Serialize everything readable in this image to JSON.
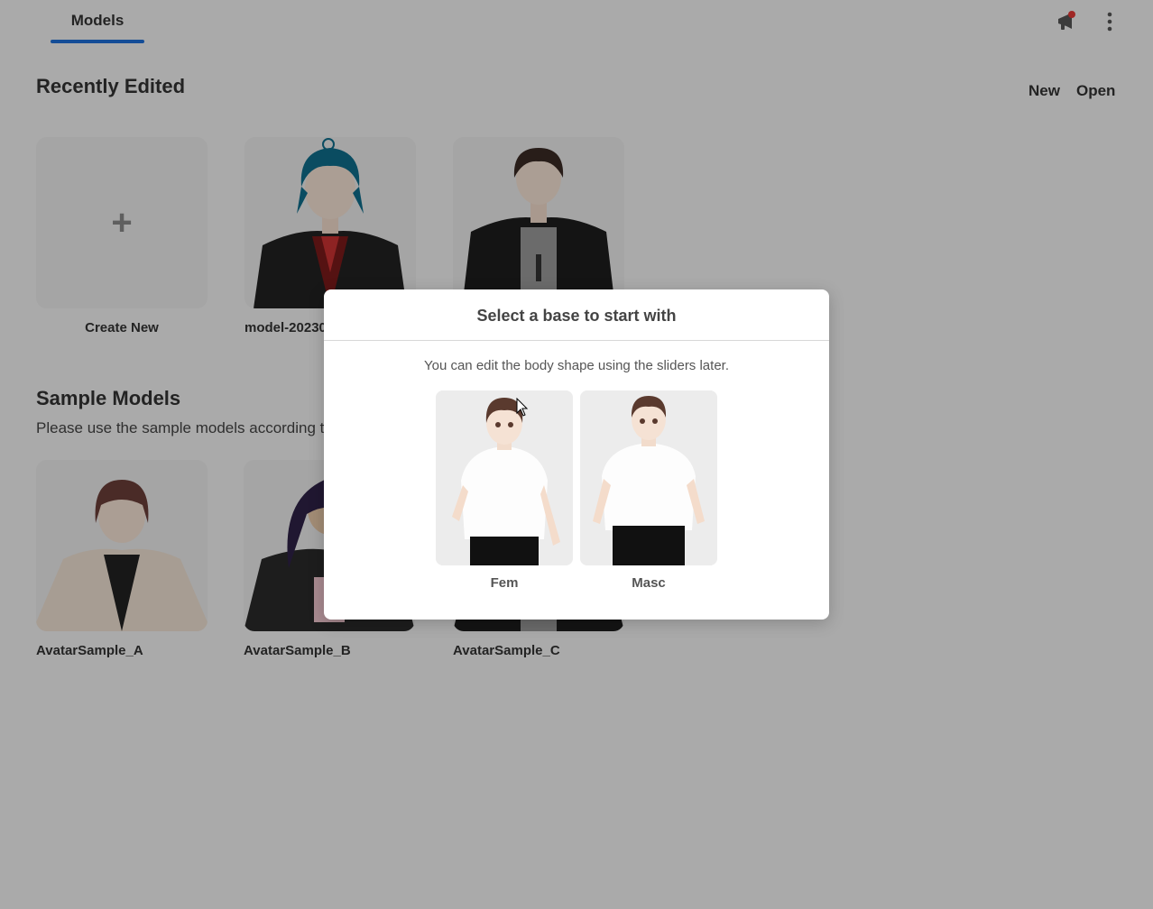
{
  "header": {
    "tab_label": "Models"
  },
  "recent": {
    "title": "Recently Edited",
    "new_label": "New",
    "open_label": "Open",
    "cards": [
      {
        "label": "Create New"
      },
      {
        "label": "model-20230"
      },
      {
        "label": ""
      }
    ]
  },
  "samples": {
    "title": "Sample Models",
    "subtitle": "Please use the sample models according to",
    "cards": [
      {
        "label": "AvatarSample_A"
      },
      {
        "label": "AvatarSample_B"
      },
      {
        "label": "AvatarSample_C"
      }
    ]
  },
  "dialog": {
    "title": "Select a base to start with",
    "description": "You can edit the body shape using the sliders later.",
    "options": [
      {
        "label": "Fem"
      },
      {
        "label": "Masc"
      }
    ]
  },
  "colors": {
    "accent": "#1e6fd9",
    "badge": "#e53935"
  }
}
